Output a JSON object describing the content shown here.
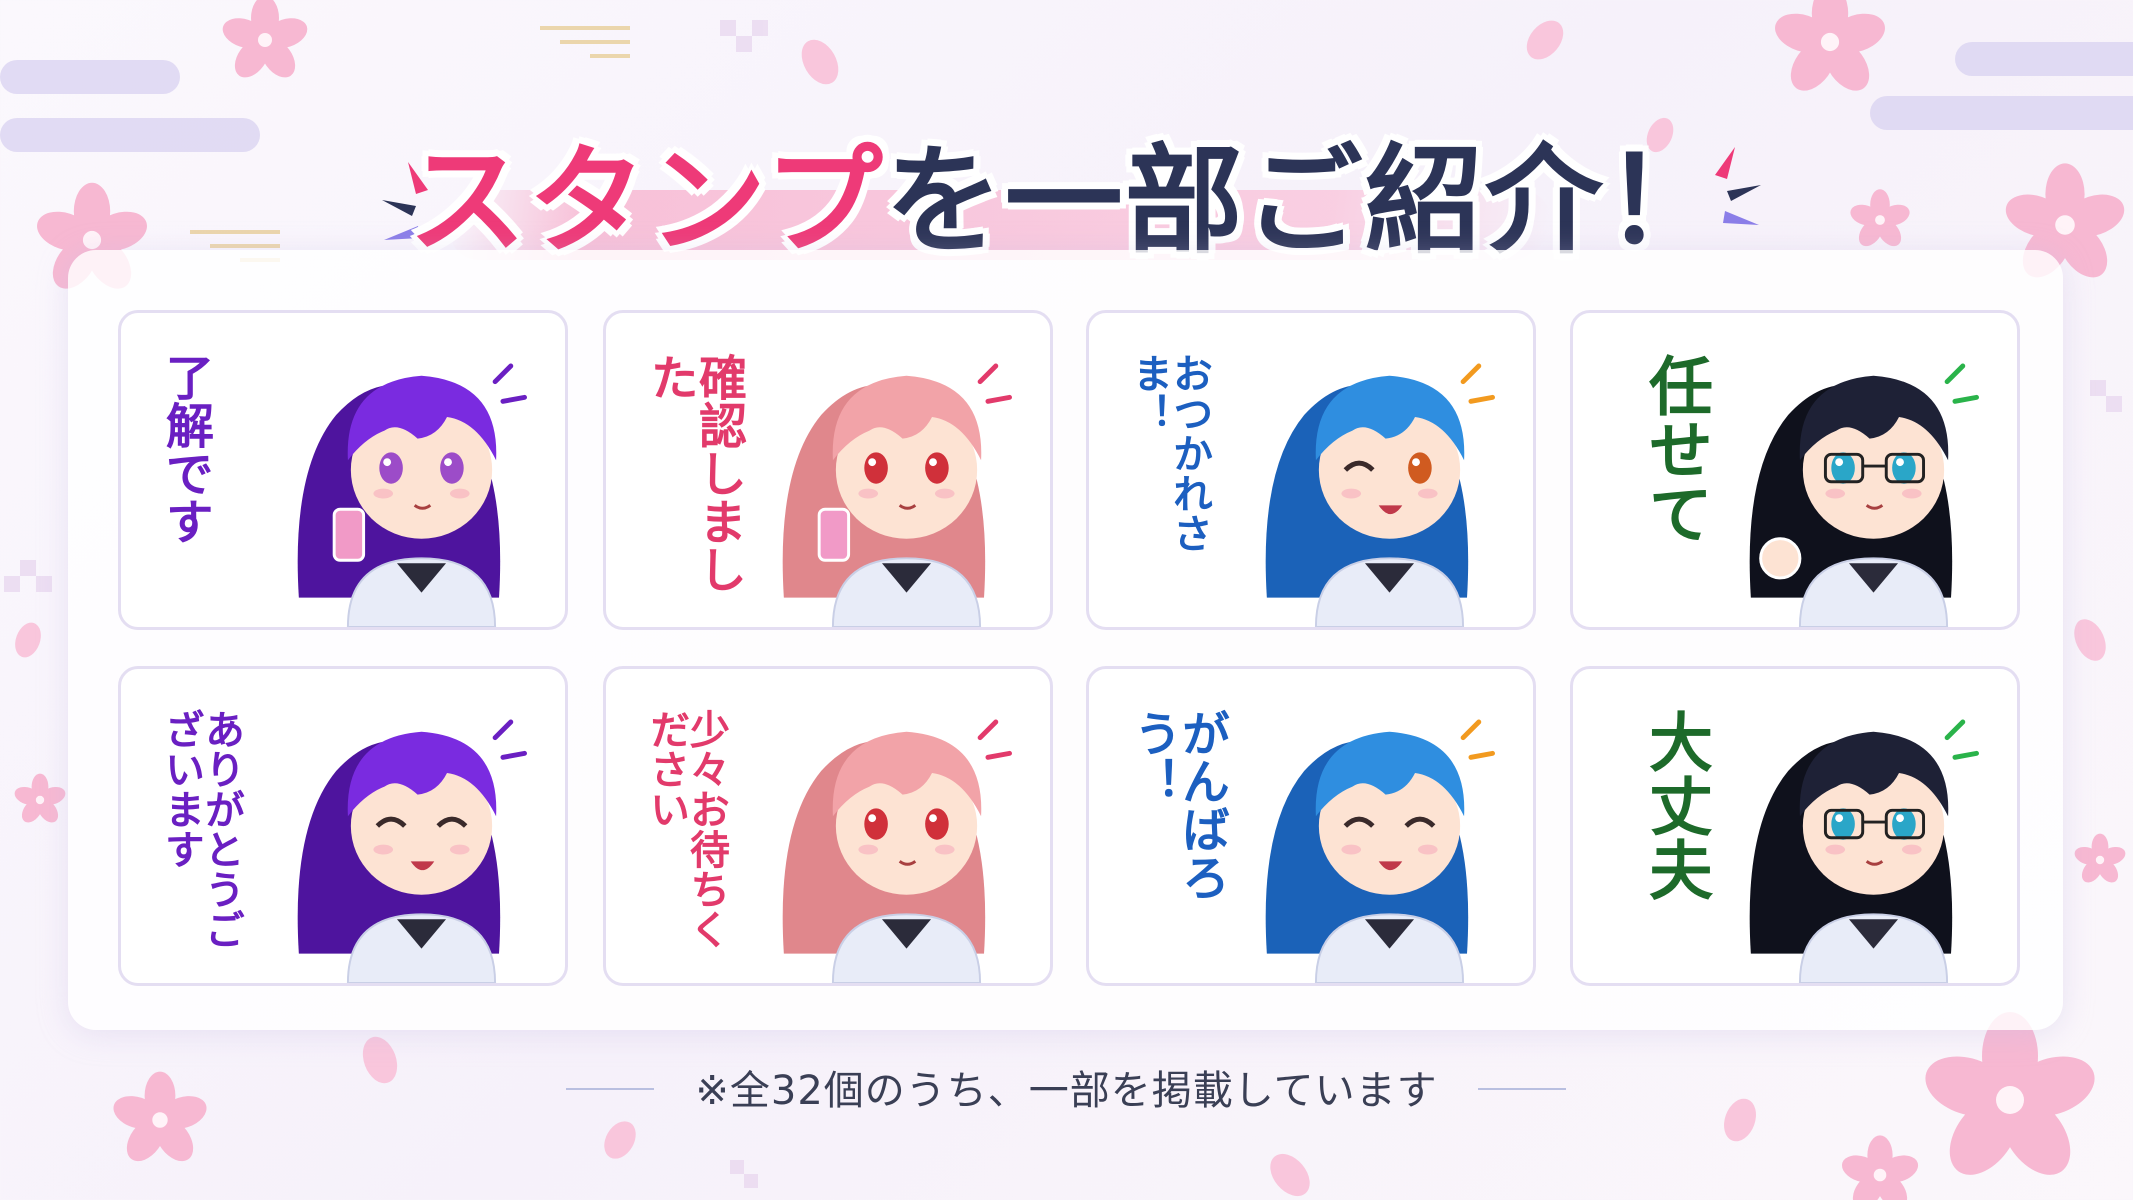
{
  "title": {
    "highlight": "スタンプ",
    "rest": "を一部ご紹介！"
  },
  "stamps": [
    {
      "text": "了解です",
      "color": "#6a1fc2",
      "hair": "#7a2be0",
      "hair_dark": "#4e149e",
      "eyes": "#9c4cc8",
      "mood": "phone"
    },
    {
      "text": "確認しました",
      "color": "#e23a6b",
      "hair": "#f2a3a8",
      "hair_dark": "#e0878c",
      "eyes": "#d0303a",
      "mood": "phone"
    },
    {
      "text": "おつかれさま！",
      "color": "#1c5fc0",
      "hair": "#2f8ee0",
      "hair_dark": "#1b62b8",
      "eyes": "#d05b20",
      "mood": "wink"
    },
    {
      "text": "任せて",
      "color": "#1d6a2a",
      "hair": "#1e2136",
      "hair_dark": "#0f111c",
      "eyes": "#2aa6c8",
      "mood": "thumb"
    },
    {
      "text": "ありがとうございます",
      "color": "#6a1fc2",
      "hair": "#7a2be0",
      "hair_dark": "#4e149e",
      "eyes": "#9c4cc8",
      "mood": "happy"
    },
    {
      "text": "少々お待ちください",
      "color": "#e23a6b",
      "hair": "#f2a3a8",
      "hair_dark": "#e0878c",
      "eyes": "#d0303a",
      "mood": "calm"
    },
    {
      "text": "がんばろう！",
      "color": "#1c5fc0",
      "hair": "#2f8ee0",
      "hair_dark": "#1b62b8",
      "eyes": "#d05b20",
      "mood": "happy"
    },
    {
      "text": "大丈夫",
      "color": "#1d6a2a",
      "hair": "#1e2136",
      "hair_dark": "#0f111c",
      "eyes": "#2aa6c8",
      "mood": "calm"
    }
  ],
  "note": "※全32個のうち、一部を掲載しています",
  "colors": {
    "title_pink": "#ee3a78",
    "title_navy": "#2c3457",
    "card_border": "#e4def2",
    "sakura": "#f7b8d2"
  }
}
